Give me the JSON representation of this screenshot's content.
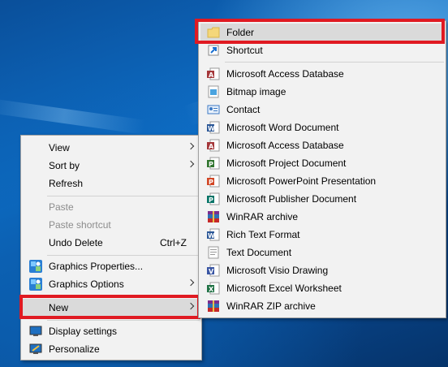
{
  "context_menu": {
    "items": [
      {
        "label": "View",
        "submenu": true
      },
      {
        "label": "Sort by",
        "submenu": true
      },
      {
        "label": "Refresh"
      },
      {
        "label": "Paste",
        "disabled": true
      },
      {
        "label": "Paste shortcut",
        "disabled": true
      },
      {
        "label": "Undo Delete",
        "shortcut": "Ctrl+Z"
      },
      {
        "label": "Graphics Properties..."
      },
      {
        "label": "Graphics Options",
        "submenu": true
      },
      {
        "label": "New",
        "submenu": true,
        "highlighted": true
      },
      {
        "label": "Display settings"
      },
      {
        "label": "Personalize"
      }
    ]
  },
  "new_submenu": {
    "items": [
      {
        "label": "Folder",
        "icon": "folder-icon",
        "highlighted": true
      },
      {
        "label": "Shortcut",
        "icon": "shortcut-icon"
      },
      {
        "label": "Microsoft Access Database",
        "icon": "access-icon"
      },
      {
        "label": "Bitmap image",
        "icon": "bitmap-icon"
      },
      {
        "label": "Contact",
        "icon": "contact-icon"
      },
      {
        "label": "Microsoft Word Document",
        "icon": "word-icon"
      },
      {
        "label": "Microsoft Access Database",
        "icon": "access-icon"
      },
      {
        "label": "Microsoft Project Document",
        "icon": "project-icon"
      },
      {
        "label": "Microsoft PowerPoint Presentation",
        "icon": "powerpoint-icon"
      },
      {
        "label": "Microsoft Publisher Document",
        "icon": "publisher-icon"
      },
      {
        "label": "WinRAR archive",
        "icon": "winrar-icon"
      },
      {
        "label": "Rich Text Format",
        "icon": "rtf-icon"
      },
      {
        "label": "Text Document",
        "icon": "text-document-icon"
      },
      {
        "label": "Microsoft Visio Drawing",
        "icon": "visio-icon"
      },
      {
        "label": "Microsoft Excel Worksheet",
        "icon": "excel-icon"
      },
      {
        "label": "WinRAR ZIP archive",
        "icon": "winrar-zip-icon"
      }
    ]
  },
  "colors": {
    "highlight_box": "#e01a22",
    "menu_bg": "#f2f2f2",
    "desktop": "#0e6fc8"
  }
}
